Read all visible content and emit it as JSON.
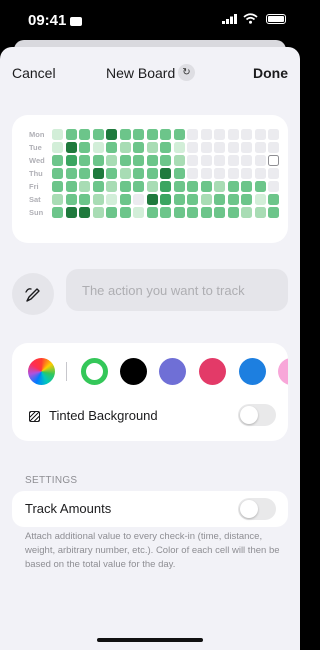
{
  "status_bar": {
    "time": "09:41"
  },
  "nav": {
    "cancel_label": "Cancel",
    "title": "New Board",
    "done_label": "Done"
  },
  "heatmap": {
    "days": [
      "Mon",
      "Tue",
      "Wed",
      "Thu",
      "Fri",
      "Sat",
      "Sun"
    ],
    "weeks": 17,
    "palette": [
      "#ebebef",
      "#d2eed8",
      "#a8dcb4",
      "#6cc58a",
      "#3ba561",
      "#1f7a3d"
    ],
    "levels": [
      [
        1,
        3,
        3,
        3,
        5,
        3,
        3,
        3,
        3,
        3,
        0,
        0,
        0,
        0,
        0,
        0,
        0
      ],
      [
        1,
        5,
        3,
        1,
        3,
        2,
        3,
        2,
        3,
        1,
        0,
        0,
        0,
        0,
        0,
        0,
        0
      ],
      [
        3,
        4,
        3,
        3,
        2,
        3,
        3,
        3,
        3,
        2,
        0,
        0,
        0,
        0,
        0,
        0,
        -1
      ],
      [
        3,
        3,
        3,
        5,
        3,
        2,
        3,
        3,
        5,
        3,
        0,
        0,
        0,
        0,
        0,
        0,
        0
      ],
      [
        3,
        3,
        2,
        3,
        2,
        3,
        3,
        2,
        4,
        3,
        3,
        3,
        2,
        3,
        3,
        3,
        0
      ],
      [
        2,
        3,
        3,
        2,
        1,
        3,
        0,
        5,
        4,
        3,
        3,
        2,
        3,
        3,
        3,
        1,
        3
      ],
      [
        3,
        5,
        5,
        2,
        3,
        3,
        1,
        3,
        3,
        3,
        3,
        3,
        3,
        3,
        2,
        2,
        3
      ]
    ]
  },
  "track_input": {
    "placeholder": "The action you want to track",
    "value": ""
  },
  "colors": {
    "swatches": [
      {
        "name": "color-wheel",
        "color": "conic"
      },
      {
        "name": "green",
        "color": "#34c759",
        "selected": true
      },
      {
        "name": "black",
        "color": "#000000"
      },
      {
        "name": "purple",
        "color": "#6f6fd6"
      },
      {
        "name": "red",
        "color": "#e33a68"
      },
      {
        "name": "blue",
        "color": "#1d7fe0"
      },
      {
        "name": "pink",
        "color": "#f8a7d9"
      }
    ],
    "tinted_background_label": "Tinted Background",
    "tinted_background_on": false
  },
  "settings": {
    "header": "SETTINGS",
    "track_amounts_label": "Track Amounts",
    "track_amounts_on": false,
    "footnote": "Attach additional value to every check-in (time, distance, weight, arbitrary number, etc.). Color of each cell will then be based on the total value for the day."
  }
}
